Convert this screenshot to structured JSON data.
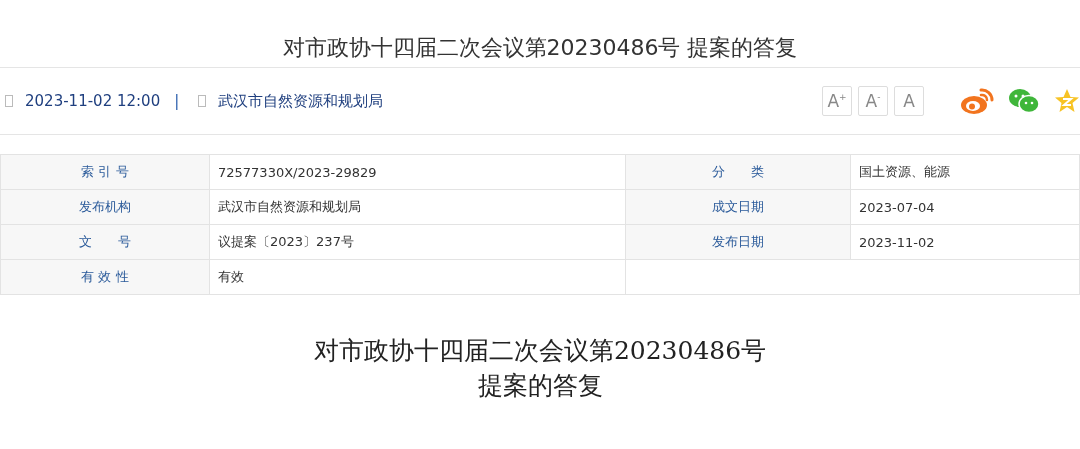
{
  "page_title": "对市政协十四届二次会议第20230486号 提案的答复",
  "meta": {
    "datetime": "2023-11-02 12:00",
    "separator": "|",
    "source": "武汉市自然资源和规划局"
  },
  "font_buttons": [
    {
      "label": "A",
      "sup": "+"
    },
    {
      "label": "A",
      "sup": "-"
    },
    {
      "label": "A"
    }
  ],
  "info_table": [
    [
      {
        "label": "索 引 号",
        "value": "72577330X/2023-29829"
      },
      {
        "label": "分　　类",
        "value": "国土资源、能源"
      }
    ],
    [
      {
        "label": "发布机构",
        "value": "武汉市自然资源和规划局"
      },
      {
        "label": "成文日期",
        "value": "2023-07-04"
      }
    ],
    [
      {
        "label": "文　　号",
        "value": "议提案〔2023〕237号"
      },
      {
        "label": "发布日期",
        "value": "2023-11-02"
      }
    ],
    [
      {
        "label": "有 效 性",
        "value": "有效"
      }
    ]
  ],
  "article_heading": [
    "对市政协十四届二次会议第20230486号",
    "提案的答复"
  ]
}
